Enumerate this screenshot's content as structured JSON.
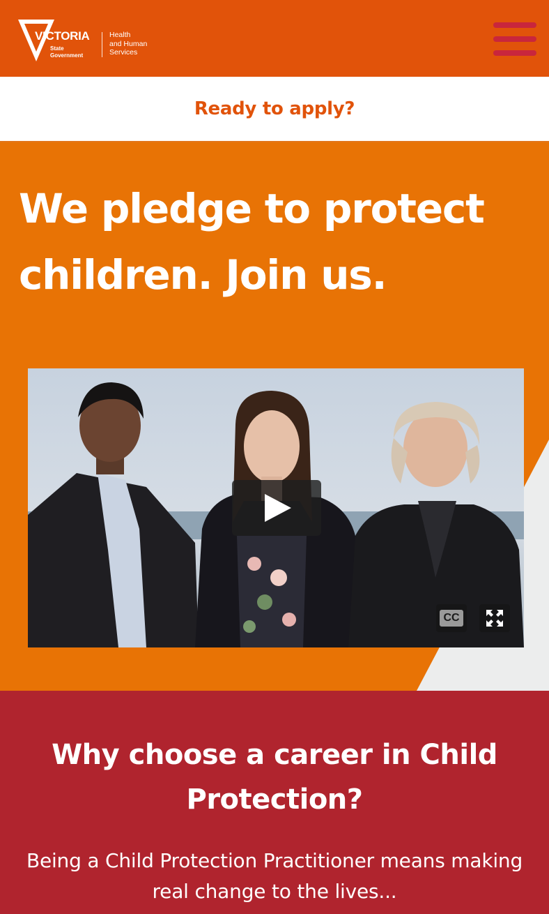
{
  "header": {
    "logo_word": "VICTORIA",
    "logo_sub_line1": "State",
    "logo_sub_line2": "Government",
    "dept_line1": "Health",
    "dept_line2": "and Human",
    "dept_line3": "Services",
    "menu_icon": "hamburger-menu-icon"
  },
  "apply_bar": {
    "link_label": "Ready to apply?"
  },
  "hero": {
    "title": "We pledge to protect children. Join us.",
    "video": {
      "play_icon": "play-icon",
      "cc_label": "CC",
      "fullscreen_icon": "fullscreen-icon"
    }
  },
  "why": {
    "title": "Why choose a career in Child Protection?",
    "body": "Being a Child Protection Practitioner means making real change to the lives..."
  },
  "colors": {
    "header_orange": "#e1530a",
    "hero_orange": "#e87305",
    "menu_red": "#c9263c",
    "section_red": "#b0242e",
    "hero_grey": "#eceded"
  }
}
